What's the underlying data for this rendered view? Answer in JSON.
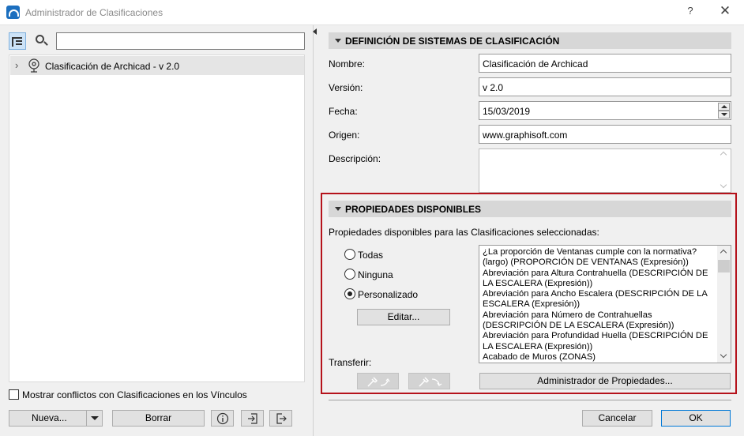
{
  "window": {
    "title": "Administrador de Clasificaciones",
    "help_glyph": "?",
    "close_glyph": "✕"
  },
  "left": {
    "search": {
      "value": "",
      "placeholder": ""
    },
    "tree": {
      "items": [
        {
          "label": "Clasificación de Archicad - v 2.0",
          "expanded": false,
          "selected": true
        }
      ]
    },
    "conflicts_checkbox": {
      "label": "Mostrar conflictos con Clasificaciones en los Vínculos",
      "checked": false
    },
    "buttons": {
      "new": "Nueva...",
      "delete": "Borrar"
    }
  },
  "definition": {
    "header": "DEFINICIÓN DE SISTEMAS DE CLASIFICACIÓN",
    "name_label": "Nombre:",
    "name_value": "Clasificación de Archicad",
    "version_label": "Versión:",
    "version_value": "v 2.0",
    "date_label": "Fecha:",
    "date_value": "15/03/2019",
    "origin_label": "Origen:",
    "origin_value": "www.graphisoft.com",
    "description_label": "Descripción:",
    "description_value": ""
  },
  "properties": {
    "header": "PROPIEDADES DISPONIBLES",
    "intro": "Propiedades disponibles para las Clasificaciones seleccionadas:",
    "options": [
      {
        "label": "Todas",
        "checked": false
      },
      {
        "label": "Ninguna",
        "checked": false
      },
      {
        "label": "Personalizado",
        "checked": true
      }
    ],
    "edit_button": "Editar...",
    "list": [
      "¿La proporción de Ventanas cumple con la normativa? (largo) (PROPORCIÓN DE VENTANAS (Expresión))",
      "Abreviación para Altura Contrahuella (DESCRIPCIÓN DE LA ESCALERA (Expresión))",
      "Abreviación para Ancho Escalera (DESCRIPCIÓN DE LA ESCALERA (Expresión))",
      "Abreviación para Número de Contrahuellas (DESCRIPCIÓN DE LA ESCALERA (Expresión))",
      "Abreviación para Profundidad Huella (DESCRIPCIÓN DE LA ESCALERA (Expresión))",
      "Acabado de Muros (ZONAS)"
    ],
    "transfer_label": "Transferir:",
    "manager_button": "Administrador de Propiedades..."
  },
  "footer": {
    "cancel": "Cancelar",
    "ok": "OK"
  },
  "colors": {
    "highlight_frame": "#b5121b",
    "primary_border": "#0078d7",
    "section_header": "#d7d7d7"
  }
}
